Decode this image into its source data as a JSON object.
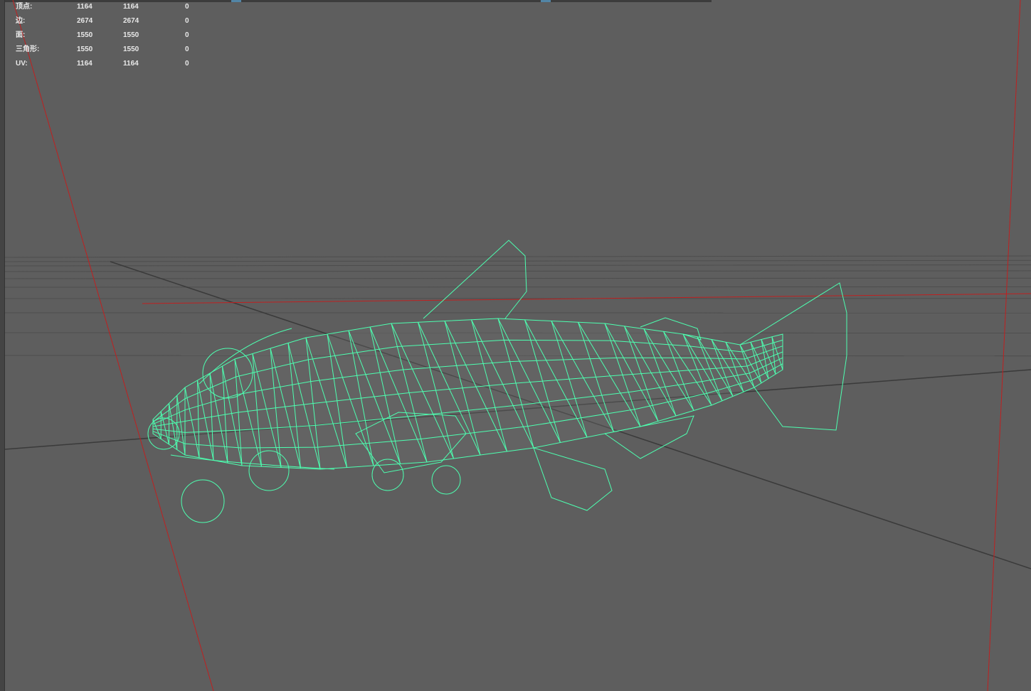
{
  "heads_up_display": {
    "poly_count": [
      {
        "label": "顶点:",
        "values": [
          "1164",
          "1164",
          "0"
        ]
      },
      {
        "label": "边:",
        "values": [
          "2674",
          "2674",
          "0"
        ]
      },
      {
        "label": "面:",
        "values": [
          "1550",
          "1550",
          "0"
        ]
      },
      {
        "label": "三角形:",
        "values": [
          "1550",
          "1550",
          "0"
        ]
      },
      {
        "label": "UV:",
        "values": [
          "1164",
          "1164",
          "0"
        ]
      }
    ]
  },
  "colors": {
    "background": "#5e5e5e",
    "wireframe": "#4dffb0",
    "grid": "#4a4a4a",
    "camera_line": "#c02020"
  }
}
